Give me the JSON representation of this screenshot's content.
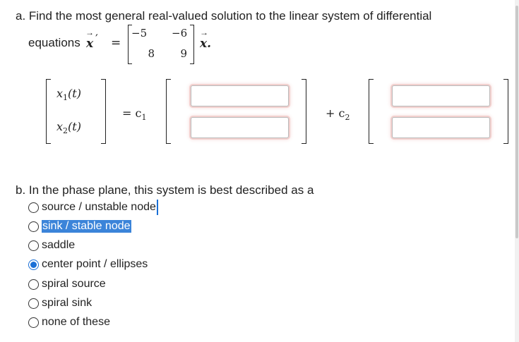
{
  "part_a": {
    "line1": "a. Find the most general real-valued solution to the linear system of differential",
    "line2_prefix": "equations ",
    "vec_x": "x",
    "prime": "′",
    "equals": "=",
    "matrix": [
      [
        "−5",
        "−6"
      ],
      [
        "8",
        "9"
      ]
    ],
    "trailing": "x.",
    "x1_label": "x",
    "x1_sub": "1",
    "x2_label": "x",
    "x2_sub": "2",
    "t_arg": "(t)",
    "eq_c1": "= c",
    "c1_sub": "1",
    "plus_c2": "+ c",
    "c2_sub": "2",
    "inputs": [
      {
        "value": "",
        "placeholder": ""
      },
      {
        "value": "",
        "placeholder": ""
      },
      {
        "value": "",
        "placeholder": ""
      },
      {
        "value": "",
        "placeholder": ""
      }
    ]
  },
  "part_b": {
    "question": "b. In the phase plane, this system is best described as a",
    "options": [
      {
        "label": "source / unstable node",
        "checked": false
      },
      {
        "label": "sink / stable node",
        "checked": false,
        "highlighted": true
      },
      {
        "label": "saddle",
        "checked": false
      },
      {
        "label": "center point / ellipses",
        "checked": true
      },
      {
        "label": "spiral source",
        "checked": false
      },
      {
        "label": "spiral sink",
        "checked": false
      },
      {
        "label": "none of these",
        "checked": false
      }
    ]
  },
  "colors": {
    "accent": "#1a6fd6",
    "selection": "#3b84d9",
    "input_glow": "#f3d1cf"
  }
}
